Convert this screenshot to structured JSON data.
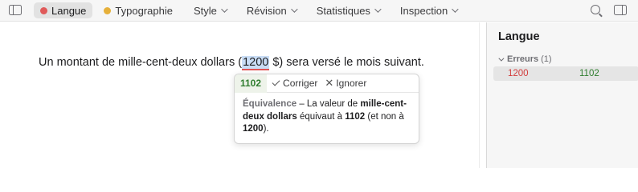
{
  "toolbar": {
    "tabs": [
      {
        "label": "Langue",
        "dot_color": "#e05a5a",
        "active": true
      },
      {
        "label": "Typographie",
        "dot_color": "#e6b03a",
        "active": false
      },
      {
        "label": "Style",
        "active": false
      },
      {
        "label": "Révision",
        "active": false
      },
      {
        "label": "Statistiques",
        "active": false
      },
      {
        "label": "Inspection",
        "active": false
      }
    ]
  },
  "document": {
    "before": "Un montant de mille-cent-deux dollars (",
    "error_text": "1200",
    "after": " $) sera versé le mois suivant."
  },
  "popover": {
    "suggestion": "1102",
    "fix_label": "Corriger",
    "ignore_label": "Ignorer",
    "term": "Équivalence",
    "dash": " – La valeur de ",
    "phrase": "mille-cent-deux dollars",
    "mid": " équivaut à ",
    "correct": "1102",
    "mid2": " (et non à ",
    "wrong": "1200",
    "end": ")."
  },
  "inspector": {
    "title": "Langue",
    "section_label": "Erreurs",
    "section_count": "(1)",
    "rows": [
      {
        "from": "1200",
        "to": "1102"
      }
    ]
  },
  "colors": {
    "error": "#d23c3c",
    "fix": "#2f7d2f",
    "highlight": "#c9ddf5"
  }
}
